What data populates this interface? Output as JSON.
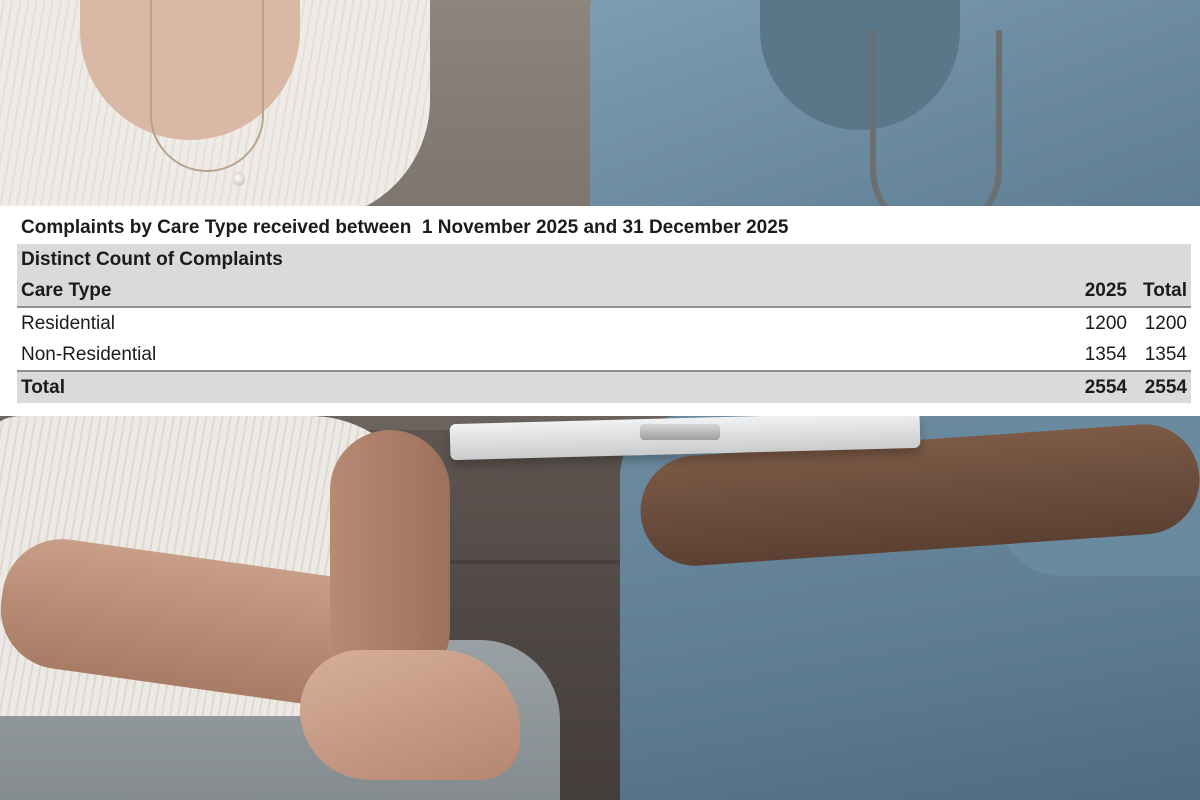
{
  "report": {
    "title": "Complaints by Care Type received between  1 November 2025 and 31 December 2025",
    "measure": "Distinct Count of Complaints",
    "columns": {
      "label": "Care Type",
      "year": "2025",
      "total": "Total"
    },
    "rows": [
      {
        "label": "Residential",
        "year": "1200",
        "total": "1200"
      },
      {
        "label": "Non-Residential",
        "year": "1354",
        "total": "1354"
      }
    ],
    "totals": {
      "label": "Total",
      "year": "2554",
      "total": "2554"
    }
  },
  "colors": {
    "band": "#dadada",
    "rule": "#8f8f8f",
    "text": "#1b1b1b",
    "scrubs": "#6d8ca1",
    "blouse": "#ece9e4"
  }
}
